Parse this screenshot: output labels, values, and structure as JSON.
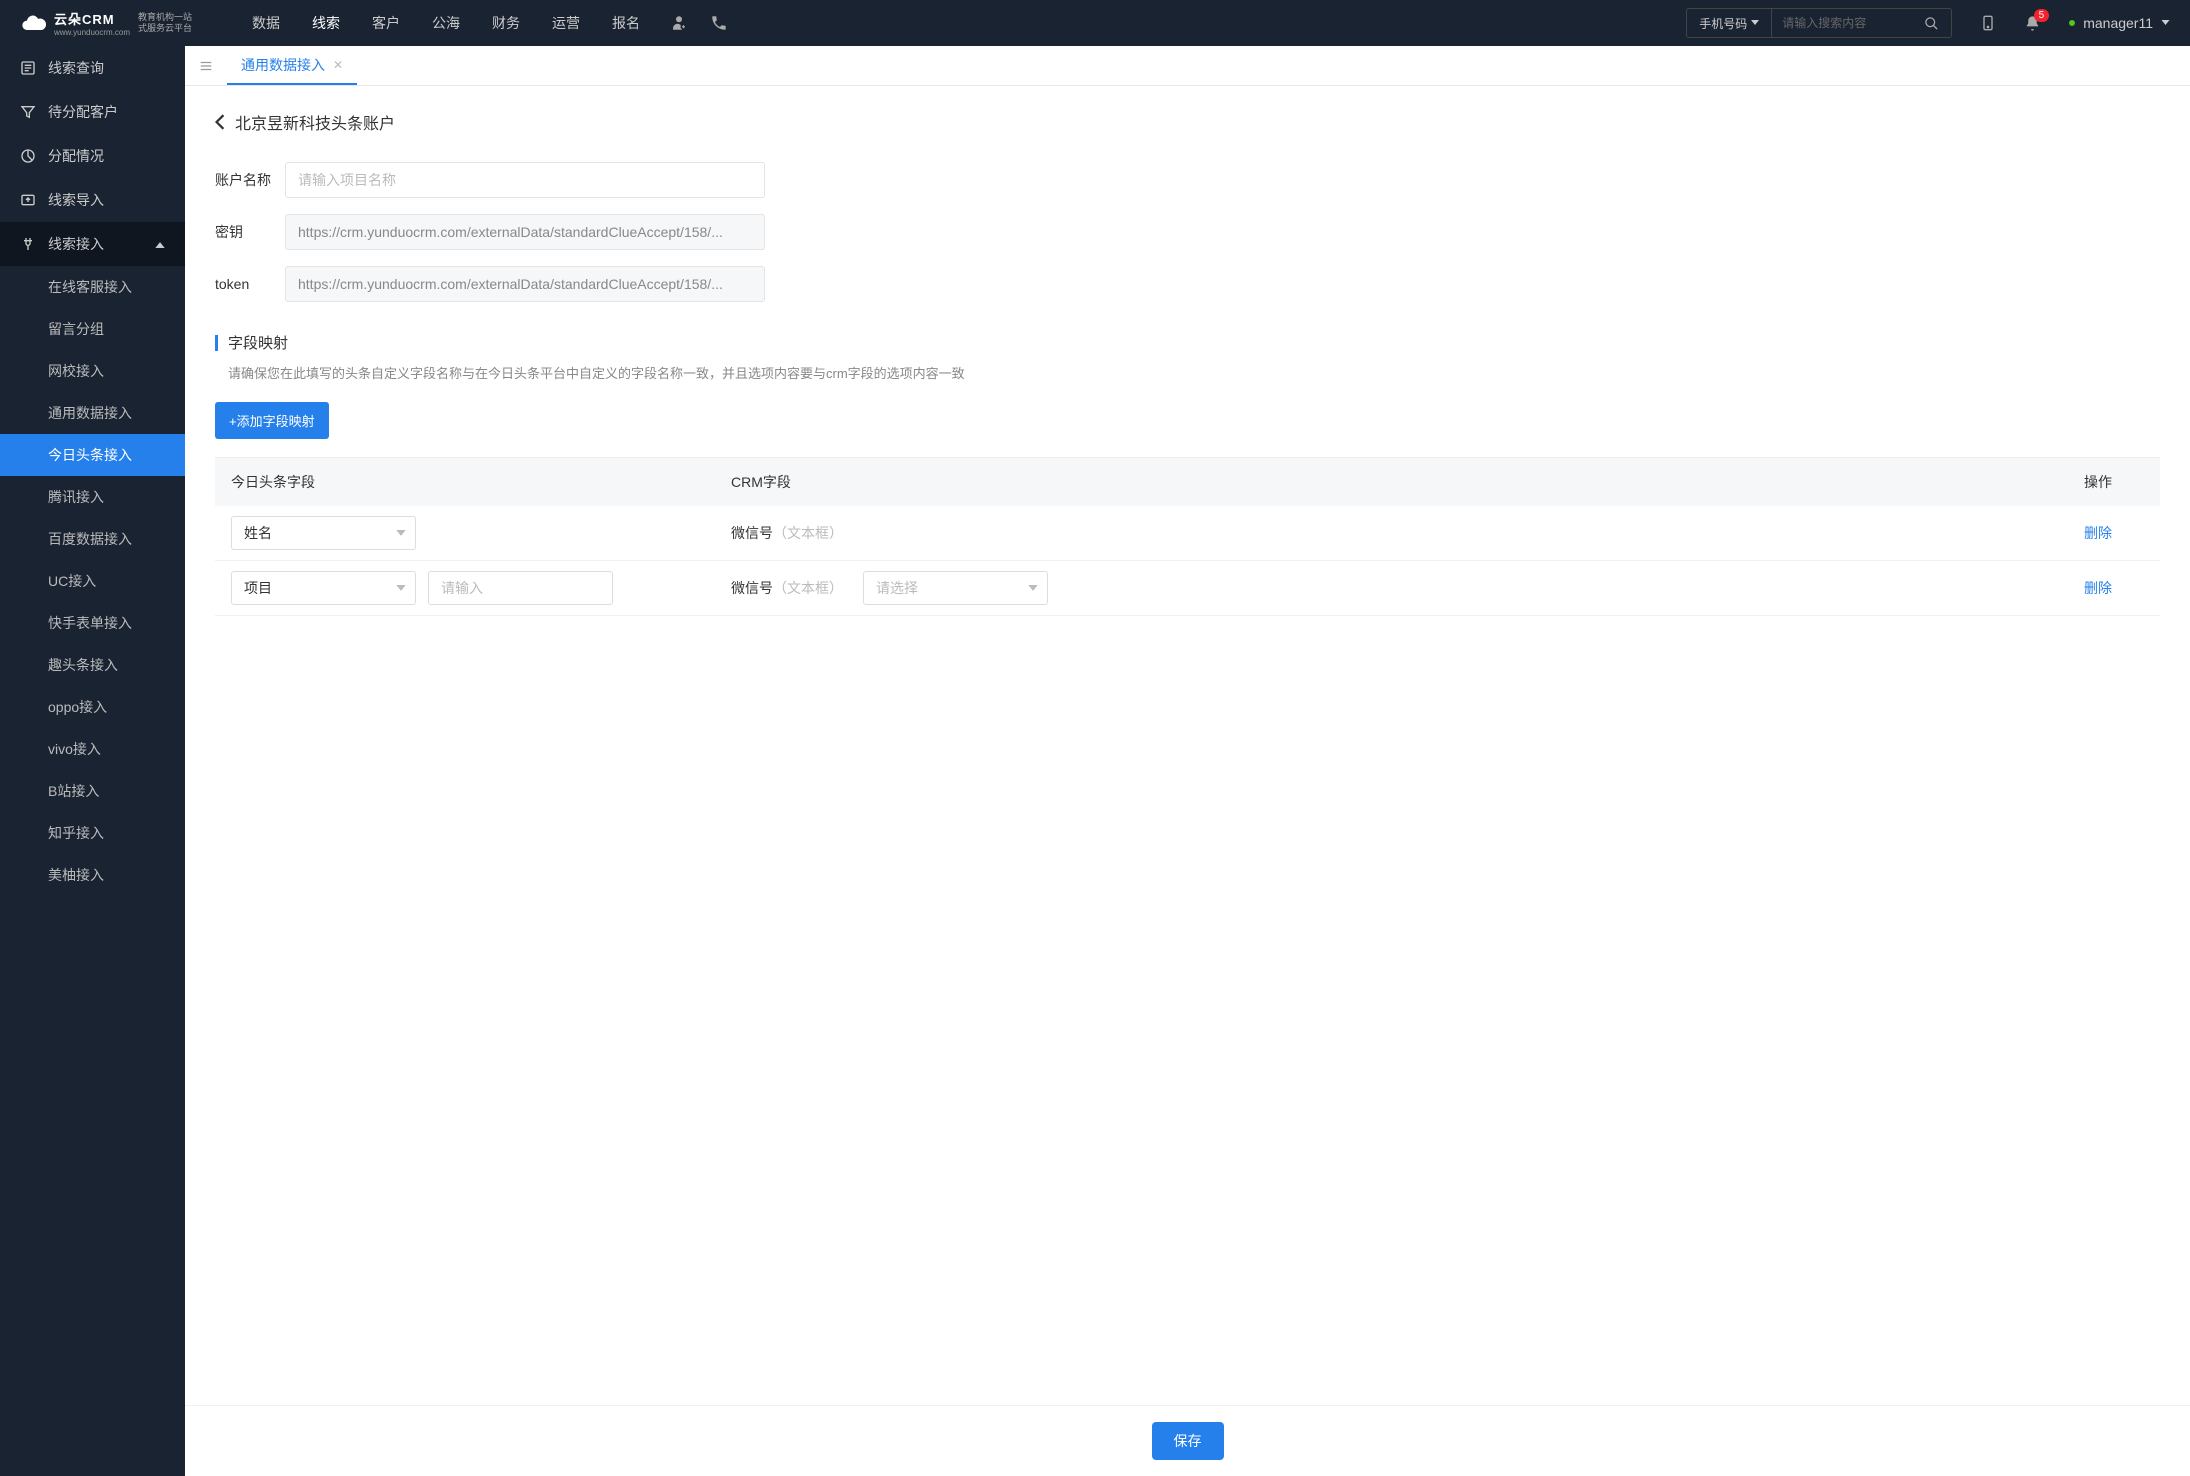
{
  "header": {
    "logo_title": "云朵CRM",
    "logo_subtitle": "www.yunduocrm.com",
    "logo_desc_line1": "教育机构一站",
    "logo_desc_line2": "式服务云平台",
    "nav": [
      "数据",
      "线索",
      "客户",
      "公海",
      "财务",
      "运营",
      "报名"
    ],
    "nav_active": 1,
    "search_select": "手机号码",
    "search_placeholder": "请输入搜索内容",
    "badge_count": "5",
    "username": "manager11"
  },
  "sidebar": {
    "items": [
      {
        "label": "线索查询"
      },
      {
        "label": "待分配客户"
      },
      {
        "label": "分配情况"
      },
      {
        "label": "线索导入"
      },
      {
        "label": "线索接入",
        "expanded": true,
        "children": [
          "在线客服接入",
          "留言分组",
          "网校接入",
          "通用数据接入",
          "今日头条接入",
          "腾讯接入",
          "百度数据接入",
          "UC接入",
          "快手表单接入",
          "趣头条接入",
          "oppo接入",
          "vivo接入",
          "B站接入",
          "知乎接入",
          "美柚接入"
        ],
        "active_child": 4
      }
    ]
  },
  "tabs": {
    "items": [
      {
        "label": "通用数据接入"
      }
    ],
    "active": 0
  },
  "page": {
    "title": "北京昱新科技头条账户",
    "form": {
      "account_label": "账户名称",
      "account_placeholder": "请输入项目名称",
      "secret_label": "密钥",
      "secret_value": "https://crm.yunduocrm.com/externalData/standardClueAccept/158/...",
      "token_label": "token",
      "token_value": "https://crm.yunduocrm.com/externalData/standardClueAccept/158/..."
    },
    "section": {
      "title": "字段映射",
      "desc": "请确保您在此填写的头条自定义字段名称与在今日头条平台中自定义的字段名称一致，并且选项内容要与crm字段的选项内容一致",
      "add_button": "+添加字段映射"
    },
    "table": {
      "headers": [
        "今日头条字段",
        "CRM字段",
        "操作"
      ],
      "rows": [
        {
          "field_select": "姓名",
          "text_input": null,
          "crm_field": "微信号",
          "crm_hint": "（文本框）",
          "crm_select": null,
          "action": "删除"
        },
        {
          "field_select": "项目",
          "text_input_placeholder": "请输入",
          "crm_field": "微信号",
          "crm_hint": "（文本框）",
          "crm_select_placeholder": "请选择",
          "action": "删除"
        }
      ]
    },
    "save_button": "保存"
  }
}
